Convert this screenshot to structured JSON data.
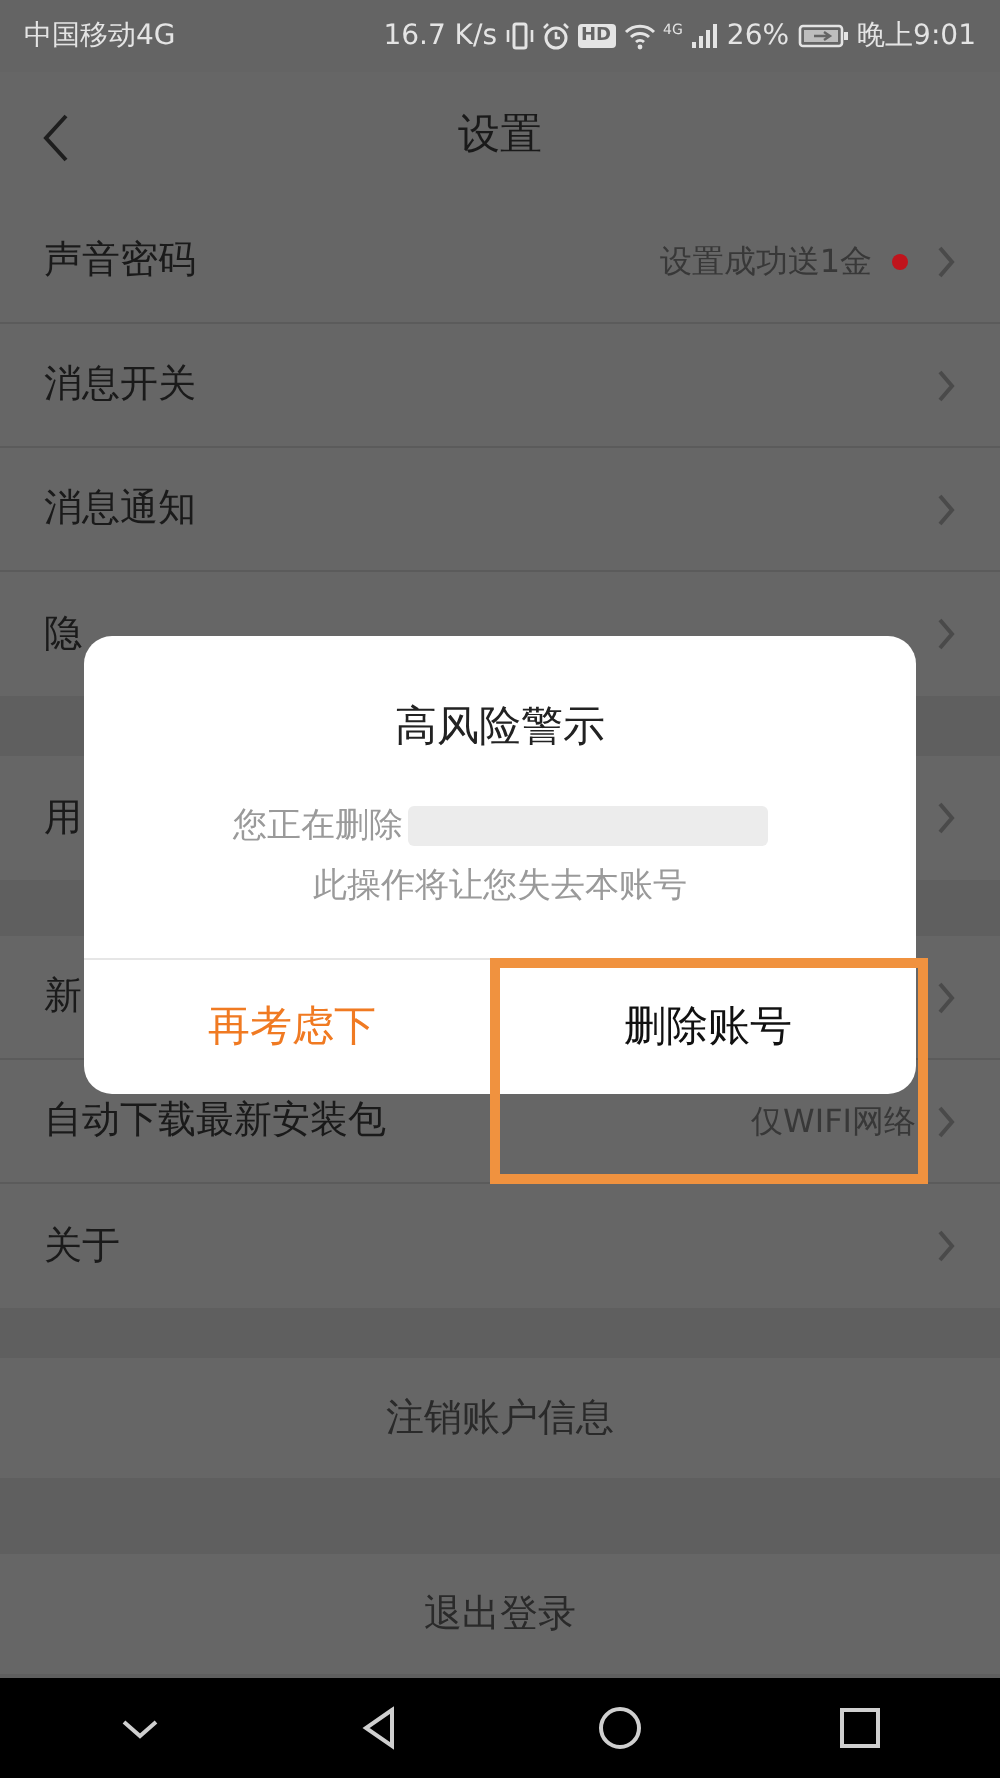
{
  "status_bar": {
    "carrier": "中国移动4G",
    "speed": "16.7 K/s",
    "hd": "HD",
    "network": "4G",
    "battery": "26%",
    "time": "晚上9:01"
  },
  "header": {
    "title": "设置"
  },
  "groups": [
    {
      "kind": "list",
      "items": [
        {
          "label": "声音密码",
          "value": "设置成功送1金",
          "unread_dot": true
        },
        {
          "label": "消息开关"
        },
        {
          "label": "消息通知"
        },
        {
          "label": "隐"
        }
      ]
    },
    {
      "kind": "list",
      "items": [
        {
          "label": "用"
        }
      ]
    },
    {
      "kind": "list",
      "items": [
        {
          "label": "新"
        },
        {
          "label": "自动下载最新安装包",
          "value": "仅WIFI网络"
        },
        {
          "label": "关于"
        }
      ]
    },
    {
      "kind": "action",
      "items": [
        {
          "label": "注销账户信息"
        }
      ]
    },
    {
      "kind": "action",
      "items": [
        {
          "label": "退出登录"
        }
      ]
    }
  ],
  "dialog": {
    "title": "高风险警示",
    "message_lines": [
      "您正在删除",
      "此操作将让您失去本账号"
    ],
    "redacted": true,
    "buttons": [
      {
        "label": "再考虑下",
        "kind": "cancel",
        "highlighted": false
      },
      {
        "label": "删除账号",
        "kind": "confirm",
        "highlighted": true
      }
    ]
  }
}
